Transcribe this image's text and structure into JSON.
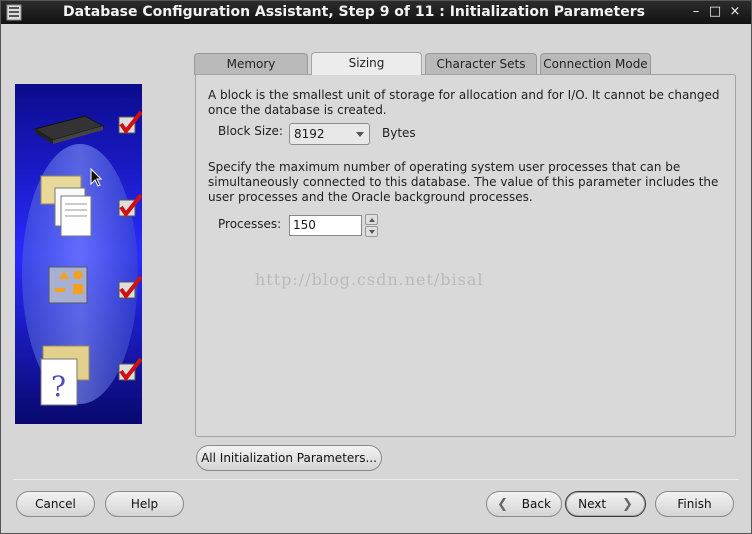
{
  "window": {
    "title": "Database Configuration Assistant, Step 9 of 11 : Initialization Parameters",
    "controls": {
      "minimize": "–",
      "maximize": "□",
      "close": "×"
    }
  },
  "tabs": [
    {
      "label": "Memory",
      "active": false
    },
    {
      "label": "Sizing",
      "active": true
    },
    {
      "label": "Character Sets",
      "active": false
    },
    {
      "label": "Connection Mode",
      "active": false
    }
  ],
  "sizing": {
    "block_description": "A block is the smallest unit of storage for allocation and for I/O. It cannot be changed once the database is created.",
    "block_size_label": "Block Size:",
    "block_size_value": "8192",
    "block_size_unit": "Bytes",
    "processes_description": "Specify the maximum number of operating system user processes that can be simultaneously connected to this database. The value of this parameter includes the user processes and the Oracle background processes.",
    "processes_label": "Processes:",
    "processes_value": "150"
  },
  "watermark": "http://blog.csdn.net/bisal",
  "buttons": {
    "all_params": "All Initialization Parameters...",
    "cancel": "Cancel",
    "help": "Help",
    "back": "Back",
    "next": "Next",
    "finish": "Finish"
  },
  "icons": {
    "back_chevron": "❮",
    "next_chevron": "❯"
  },
  "colors": {
    "sidepanel_blue": "#1a1ad0",
    "checkmark_red": "#d01010"
  }
}
